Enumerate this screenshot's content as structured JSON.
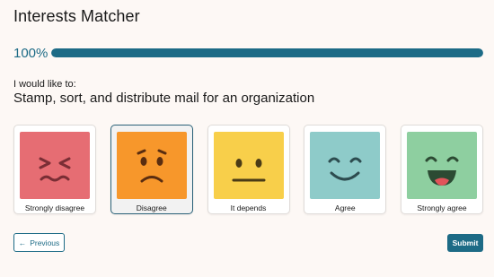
{
  "header": {
    "title": "Interests Matcher"
  },
  "progress": {
    "label": "100%",
    "value": 1.0
  },
  "survey": {
    "prompt": "I would like to:",
    "question": "Stamp, sort, and distribute mail for an organization",
    "choices": [
      {
        "label": "Strongly disagree",
        "color": "#e66d73",
        "icon": "very-unhappy-face-icon",
        "selected": false
      },
      {
        "label": "Disagree",
        "color": "#f7972b",
        "icon": "unhappy-face-icon",
        "selected": true
      },
      {
        "label": "It depends",
        "color": "#f8cf4a",
        "icon": "neutral-face-icon",
        "selected": false
      },
      {
        "label": "Agree",
        "color": "#8ecbc9",
        "icon": "happy-face-icon",
        "selected": false
      },
      {
        "label": "Strongly agree",
        "color": "#8ecfa0",
        "icon": "very-happy-face-icon",
        "selected": false
      }
    ]
  },
  "nav": {
    "previous_label": "Previous",
    "submit_label": "Submit",
    "arrow_glyph": "←"
  }
}
